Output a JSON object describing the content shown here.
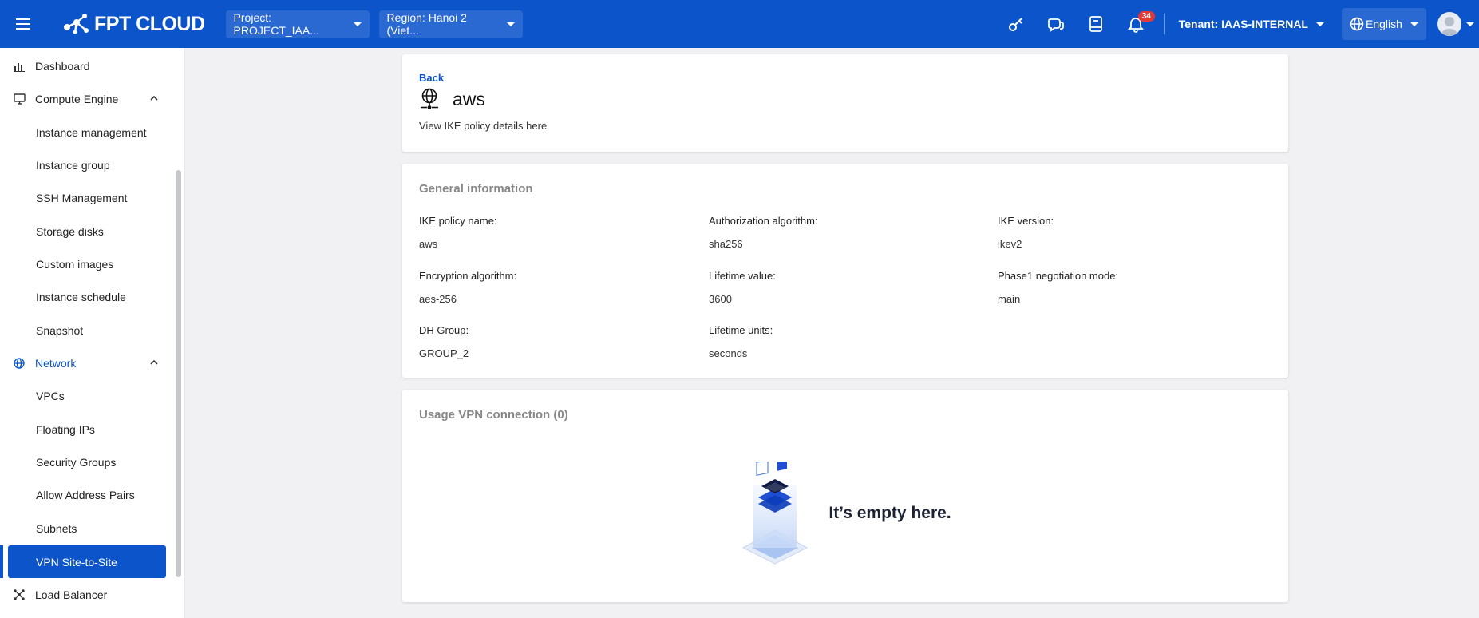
{
  "header": {
    "brand": "FPT CLOUD",
    "project": "Project: PROJECT_IAA...",
    "region": "Region: Hanoi 2 (Viet...",
    "notification_count": "34",
    "tenant": "Tenant: IAAS-INTERNAL",
    "language": "English",
    "icons": [
      "menu-icon",
      "key-icon",
      "support-icon",
      "book-icon",
      "bell-icon",
      "globe-icon",
      "user-icon"
    ]
  },
  "sidebar": {
    "items": [
      {
        "label": "Dashboard",
        "icon": "bar-chart-icon"
      },
      {
        "label": "Compute Engine",
        "icon": "monitor-icon"
      },
      {
        "label": "Instance management"
      },
      {
        "label": "Instance group"
      },
      {
        "label": "SSH Management"
      },
      {
        "label": "Storage disks"
      },
      {
        "label": "Custom images"
      },
      {
        "label": "Instance schedule"
      },
      {
        "label": "Snapshot"
      },
      {
        "label": "Network",
        "icon": "globe-icon"
      },
      {
        "label": "VPCs"
      },
      {
        "label": "Floating IPs"
      },
      {
        "label": "Security Groups"
      },
      {
        "label": "Allow Address Pairs"
      },
      {
        "label": "Subnets"
      },
      {
        "label": "VPN Site-to-Site"
      },
      {
        "label": "Load Balancer",
        "icon": "load-balancer-icon"
      }
    ]
  },
  "page": {
    "back": "Back",
    "title": "aws",
    "subtitle": "View IKE policy details here"
  },
  "general": {
    "title": "General information",
    "fields": [
      {
        "label": "IKE policy name:",
        "value": "aws"
      },
      {
        "label": "Authorization algorithm:",
        "value": "sha256"
      },
      {
        "label": "IKE version:",
        "value": "ikev2"
      },
      {
        "label": "Encryption algorithm:",
        "value": "aes-256"
      },
      {
        "label": "Lifetime value:",
        "value": "3600"
      },
      {
        "label": "Phase1 negotiation mode:",
        "value": "main"
      },
      {
        "label": "DH Group:",
        "value": "GROUP_2"
      },
      {
        "label": "Lifetime units:",
        "value": "seconds"
      }
    ]
  },
  "usage": {
    "title": "Usage VPN connection (0)",
    "empty_text": "It’s empty here."
  },
  "colors": {
    "brand_blue": "#0b54c9",
    "background": "#f1f1f3"
  }
}
